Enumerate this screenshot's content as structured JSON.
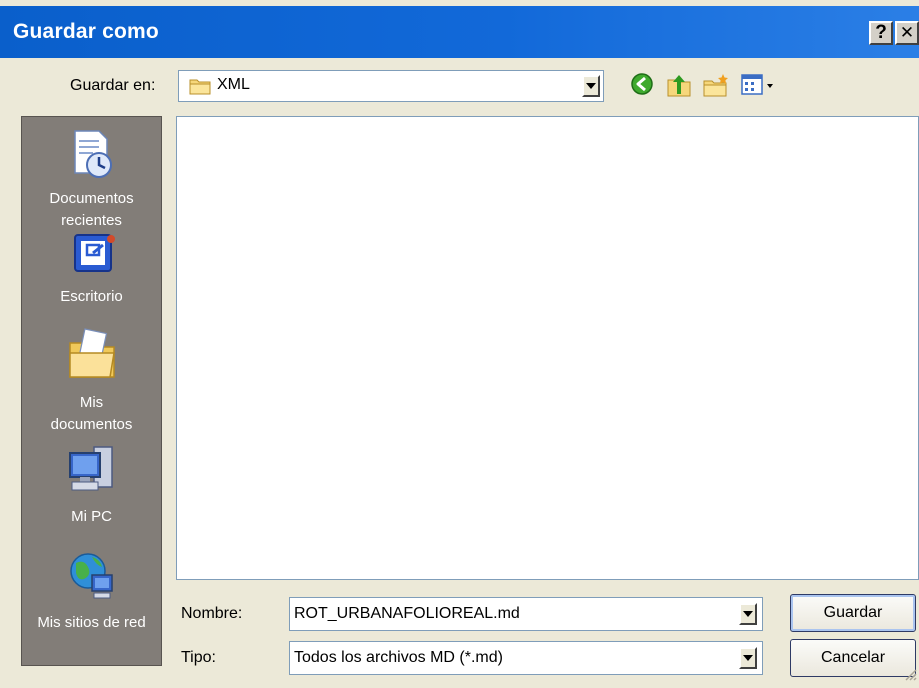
{
  "window": {
    "title": "Guardar como",
    "help_symbol": "?",
    "close_symbol": "✕"
  },
  "toolbar": {
    "save_in_label": "Guardar en:",
    "save_in_value": "XML",
    "icons": [
      "back-icon",
      "up-folder-icon",
      "new-folder-icon",
      "view-menu-icon"
    ]
  },
  "places": [
    {
      "name": "recent-documents",
      "label1": "Documentos",
      "label2": "recientes",
      "icon": "recent-documents-icon"
    },
    {
      "name": "desktop",
      "label1": "Escritorio",
      "label2": "",
      "icon": "desktop-icon"
    },
    {
      "name": "my-documents",
      "label1": "Mis",
      "label2": "documentos",
      "icon": "my-documents-icon"
    },
    {
      "name": "my-computer",
      "label1": "Mi PC",
      "label2": "",
      "icon": "my-computer-icon"
    },
    {
      "name": "my-network-places",
      "label1": "Mis sitios de red",
      "label2": "",
      "icon": "network-places-icon"
    }
  ],
  "form": {
    "name_label": "Nombre:",
    "name_value": "ROT_URBANAFOLIOREAL.md",
    "type_label": "Tipo:",
    "type_value": "Todos los archivos MD (*.md)",
    "save_button": "Guardar",
    "cancel_button": "Cancelar"
  },
  "colors": {
    "titlebar": "#0a5fcb",
    "dialog_bg": "#ece9d8",
    "places_bg": "#827d78"
  }
}
